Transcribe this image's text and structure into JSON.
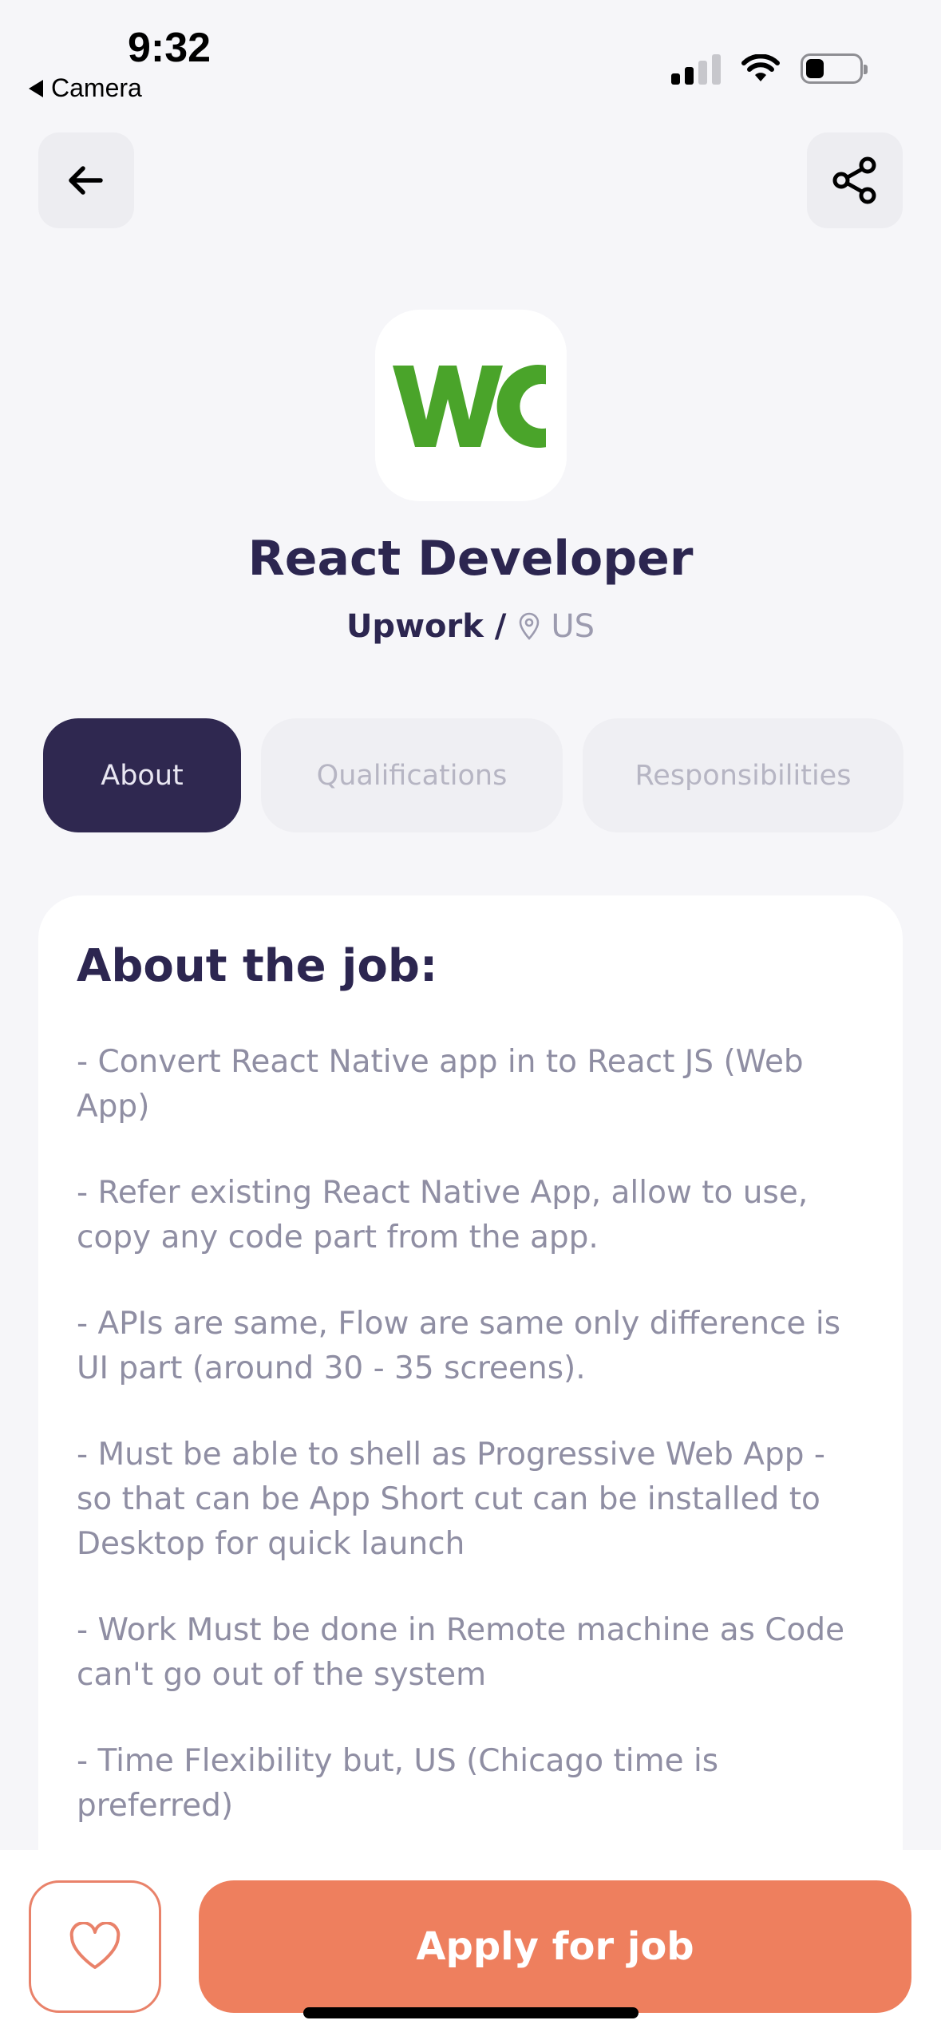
{
  "status_bar": {
    "time": "9:32",
    "back_label": "Camera"
  },
  "nav": {
    "back_icon": "arrow-left-icon",
    "share_icon": "share-icon"
  },
  "company_logo": {
    "letters": "WC",
    "color": "#4AA42A"
  },
  "job": {
    "title": "React Developer",
    "company": "Upwork /",
    "location": "US"
  },
  "tabs": [
    {
      "label": "About",
      "active": true
    },
    {
      "label": "Qualifications",
      "active": false
    },
    {
      "label": "Responsibilities",
      "active": false
    }
  ],
  "about": {
    "heading": "About the job:",
    "paragraphs": [
      "- Convert React Native app in to React JS (Web App)",
      "- Refer existing React Native App, allow to use, copy any code part from the app.",
      "- APIs are same, Flow are same only difference is UI part (around 30 - 35 screens).",
      "- Must be able to shell as Progressive Web App - so that can be App Short cut can be installed to Desktop for quick launch",
      "- Work Must be done in Remote machine as Code can't go out of the system",
      "- Time Flexibility but, US (Chicago time is preferred)"
    ]
  },
  "actions": {
    "favorite_icon": "heart-icon",
    "apply_label": "Apply for job"
  },
  "colors": {
    "primary_dark": "#2F2850",
    "accent": "#EE7F5E",
    "background": "#F6F6F9"
  }
}
